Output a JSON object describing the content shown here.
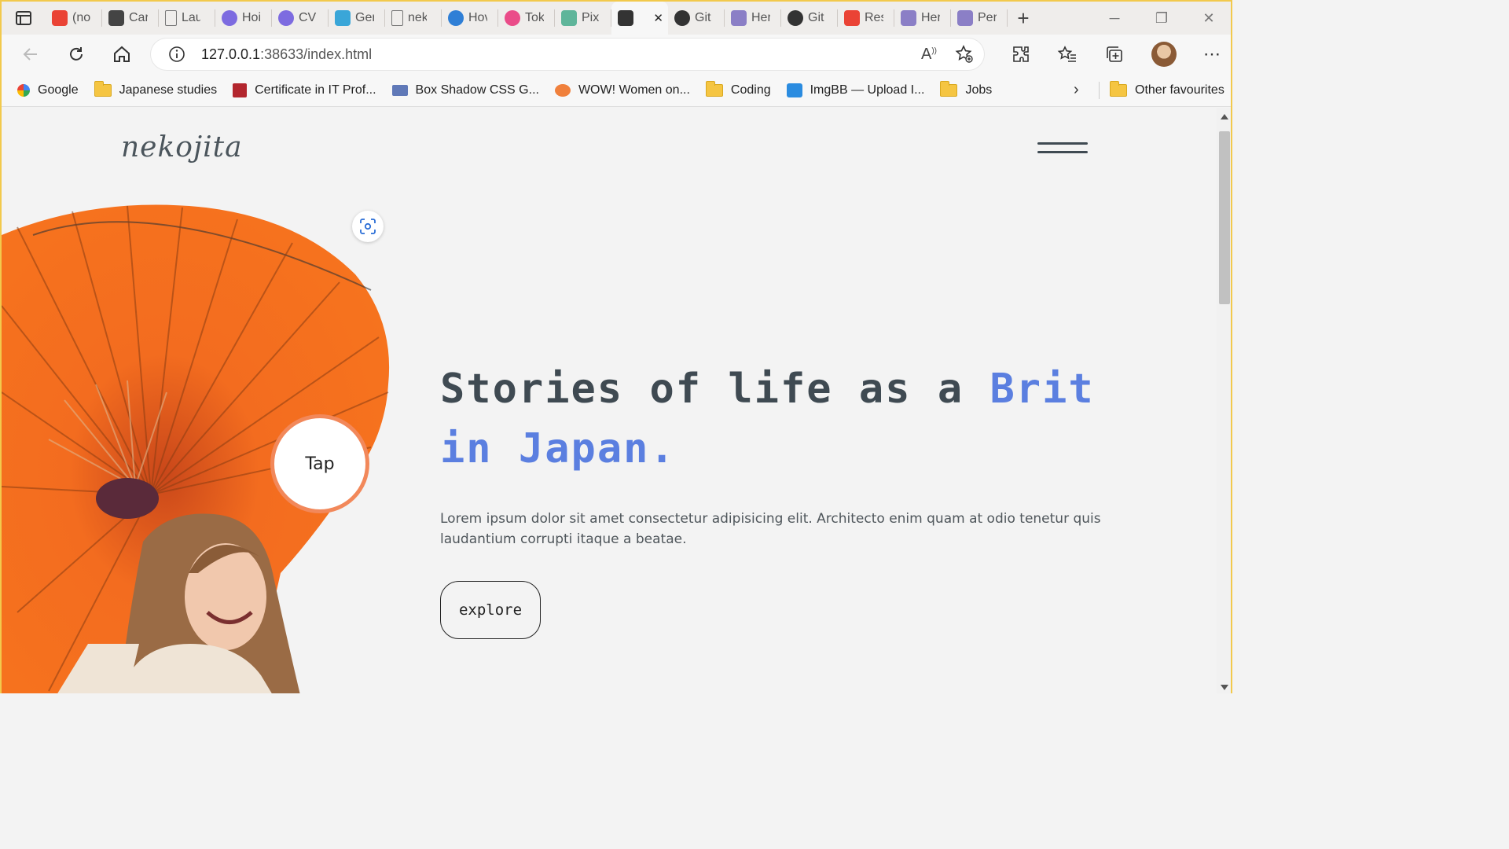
{
  "browser": {
    "tabs": [
      {
        "label": "(no",
        "icon": "gmail-icon",
        "color": "#ea4335"
      },
      {
        "label": "Car",
        "icon": "notion-icon",
        "color": "#444444"
      },
      {
        "label": "Lau",
        "icon": "document-icon",
        "color": "#777777"
      },
      {
        "label": "Hoi",
        "icon": "canva-icon",
        "color": "#7d6be0"
      },
      {
        "label": "CV",
        "icon": "canva-icon",
        "color": "#7d6be0"
      },
      {
        "label": "Ger",
        "icon": "diamond-icon",
        "color": "#3aa6d8"
      },
      {
        "label": "nek",
        "icon": "document-icon",
        "color": "#777777"
      },
      {
        "label": "Hov",
        "icon": "spiral-icon",
        "color": "#2f7fd6"
      },
      {
        "label": "Tok",
        "icon": "dribbble-icon",
        "color": "#ea4c89"
      },
      {
        "label": "Pix",
        "icon": "pixel-icon",
        "color": "#5fb59a"
      },
      {
        "label": "",
        "icon": "podcast-icon",
        "color": "#333333",
        "active": true
      },
      {
        "label": "Git",
        "icon": "github-icon",
        "color": "#333333"
      },
      {
        "label": "Her",
        "icon": "heroku-icon",
        "color": "#8b7fc6"
      },
      {
        "label": "Git",
        "icon": "github-icon",
        "color": "#333333"
      },
      {
        "label": "Res",
        "icon": "gmail-icon",
        "color": "#ea4335"
      },
      {
        "label": "Her",
        "icon": "heroku-icon",
        "color": "#8b7fc6"
      },
      {
        "label": "Per",
        "icon": "heroku-icon",
        "color": "#8b7fc6"
      }
    ],
    "url_host": "127.0.0.1",
    "url_path": ":38633/index.html",
    "bookmarks": [
      {
        "label": "Google",
        "icon": "google-icon"
      },
      {
        "label": "Japanese studies",
        "icon": "folder-icon"
      },
      {
        "label": "Certificate in IT Prof...",
        "icon": "t-logo-icon"
      },
      {
        "label": "Box Shadow CSS G...",
        "icon": "box-icon"
      },
      {
        "label": "WOW! Women on...",
        "icon": "wow-icon"
      },
      {
        "label": "Coding",
        "icon": "folder-icon"
      },
      {
        "label": "ImgBB — Upload I...",
        "icon": "ibb-icon"
      },
      {
        "label": "Jobs",
        "icon": "folder-icon"
      }
    ],
    "other_favourites": "Other favourites"
  },
  "site": {
    "logo": "nekojita",
    "tap_label": "Tap",
    "headline_plain": "Stories of life as a ",
    "headline_accent": "Brit in Japan.",
    "lede": "Lorem ipsum dolor sit amet consectetur adipisicing elit. Architecto enim quam at odio tenetur quis laudantium corrupti itaque a beatae.",
    "cta": "explore"
  },
  "colors": {
    "accent": "#5b7fe0",
    "text_dark": "#3f4a52",
    "umbrella": "#f26a1b",
    "tap_ring": "#f2885a"
  }
}
